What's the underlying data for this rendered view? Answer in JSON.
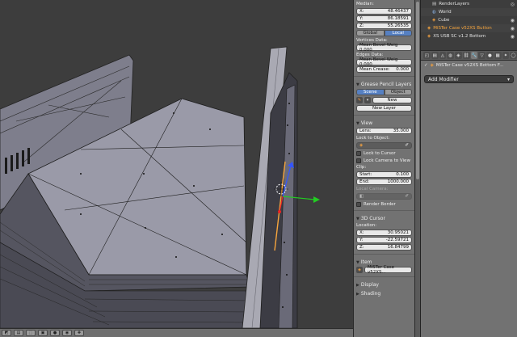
{
  "npanel": {
    "median_label": "Median:",
    "median": {
      "x": "X:",
      "x_val": "48.46437",
      "y": "Y:",
      "y_val": "86.18591",
      "z": "Z:",
      "z_val": "55.26535"
    },
    "tabs": {
      "global": "Global",
      "local": "Local"
    },
    "vertices_data": "Vertices Data:",
    "mean_bevel_weight_v": "Mean Bevel Weig 0.000",
    "edges_data": "Edges Data:",
    "mean_bevel_weight_e": "Mean Bevel Weig 0.000",
    "mean_crease": "Mean Crease:",
    "mean_crease_val": "0.000",
    "grease_pencil": "Grease Pencil Layers",
    "gp_tabs": {
      "scene": "Scene",
      "object": "Object"
    },
    "gp_new": "New",
    "gp_new_layer": "New Layer",
    "view_header": "View",
    "lens_label": "Lens:",
    "lens_val": "35.000",
    "lock_to_object": "Lock to Object:",
    "lock_to_cursor": "Lock to Cursor",
    "lock_camera": "Lock Camera to View",
    "clip_label": "Clip:",
    "clip_start": "Start:",
    "clip_start_val": "0.100",
    "clip_end": "End:",
    "clip_end_val": "1000.000",
    "local_camera": "Local Camera:",
    "render_border": "Render Border",
    "cursor_header": "3D Cursor",
    "location_label": "Location:",
    "cursor": {
      "x": "X:",
      "x_val": "30.95021",
      "y": "Y:",
      "y_val": "-22.59721",
      "z": "Z:",
      "z_val": "16.84799"
    },
    "item_header": "Item",
    "item_name": "MiSTer Case v52XS...",
    "display_header": "Display",
    "shading_header": "Shading"
  },
  "outliner": {
    "items": [
      {
        "label": "RenderLayers",
        "icon": "render-layers-icon"
      },
      {
        "label": "World",
        "icon": "world-icon"
      },
      {
        "label": "Cube",
        "icon": "mesh-icon"
      },
      {
        "label": "MiSTer Case v52XS Button",
        "icon": "mesh-icon"
      },
      {
        "label": "XS USB SC v1.2 Bottom",
        "icon": "mesh-icon"
      }
    ]
  },
  "properties": {
    "path": "MiSTer Case v52XS Bottom F...",
    "add_modifier": "Add Modifier"
  },
  "colors": {
    "viewport_bg": "#3d3d3d",
    "mesh_face": "#9a9aa8",
    "mesh_edge": "#1e1e1e",
    "accent_blue": "#5680c2",
    "selected_orange": "#f7a53d"
  }
}
